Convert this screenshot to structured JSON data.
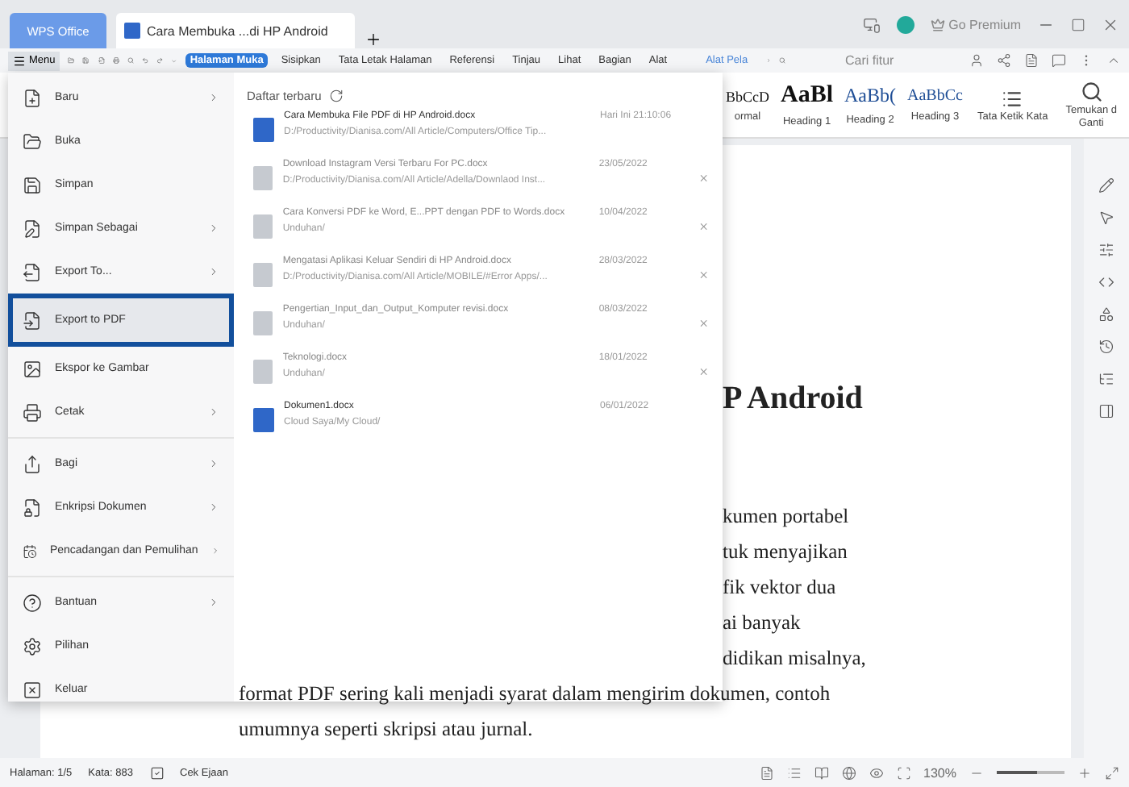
{
  "window": {
    "app_tab": "WPS Office",
    "document_tab": "Cara Membuka ...di HP Android",
    "premium": "Go Premium"
  },
  "toolbar": {
    "menu": "Menu",
    "tabs": [
      {
        "label": "Halaman Muka",
        "selected": true
      },
      {
        "label": "Sisipkan",
        "selected": false
      },
      {
        "label": "Tata Letak Halaman",
        "selected": false
      },
      {
        "label": "Referensi",
        "selected": false
      },
      {
        "label": "Tinjau",
        "selected": false
      },
      {
        "label": "Lihat",
        "selected": false
      },
      {
        "label": "Bagian",
        "selected": false
      },
      {
        "label": "Alat",
        "selected": false
      }
    ],
    "context_tab": "Alat Pela",
    "search": {
      "placeholder": "Cari fitur"
    }
  },
  "ribbon": {
    "styles": [
      {
        "preview": "BbCcD",
        "name": "ormal",
        "kind": "normal"
      },
      {
        "preview": "AaBl",
        "name": "Heading 1",
        "kind": "h1"
      },
      {
        "preview": "AaBb(",
        "name": "Heading 2",
        "kind": "h2"
      },
      {
        "preview": "AaBbCc",
        "name": "Heading 3",
        "kind": "h3"
      }
    ],
    "typesetting": "Tata Ketik Kata",
    "find": [
      "Temukan d",
      "Ganti"
    ]
  },
  "file_menu": {
    "groups": [
      [
        {
          "label": "Baru",
          "submenu": true,
          "selected": false
        },
        {
          "label": "Buka",
          "submenu": false,
          "selected": false
        },
        {
          "label": "Simpan",
          "submenu": false,
          "selected": false
        },
        {
          "label": "Simpan Sebagai",
          "submenu": true,
          "selected": false
        },
        {
          "label": "Export To...",
          "submenu": true,
          "selected": false
        },
        {
          "label": "Export to PDF",
          "submenu": false,
          "selected": true
        },
        {
          "label": "Ekspor ke Gambar",
          "submenu": false,
          "selected": false
        },
        {
          "label": "Cetak",
          "submenu": true,
          "selected": false
        }
      ],
      [
        {
          "label": "Bagi",
          "submenu": true,
          "selected": false
        },
        {
          "label": "Enkripsi Dokumen",
          "submenu": true,
          "selected": false
        },
        {
          "label": "Pencadangan dan Pemulihan",
          "submenu": true,
          "selected": false
        }
      ],
      [
        {
          "label": "Bantuan",
          "submenu": true,
          "selected": false
        },
        {
          "label": "Pilihan",
          "submenu": false,
          "selected": false
        },
        {
          "label": "Keluar",
          "submenu": false,
          "selected": false
        }
      ]
    ]
  },
  "recent": {
    "title": "Daftar terbaru",
    "files": [
      {
        "name": "Cara Membuka File PDF di HP Android.docx",
        "path": "D:/Productivity/Dianisa.com/All Article/Computers/Office Tip...",
        "date": "Hari Ini 21:10:06",
        "active": true,
        "removable": false
      },
      {
        "name": "Download Instagram Versi Terbaru For PC.docx",
        "path": "D:/Productivity/Dianisa.com/All Article/Adella/Downlaod Inst...",
        "date": "23/05/2022",
        "active": false,
        "removable": true
      },
      {
        "name": "Cara Konversi PDF ke Word, E...PPT dengan PDF to Words.docx",
        "path": "Unduhan/",
        "date": "10/04/2022",
        "active": false,
        "removable": true
      },
      {
        "name": "Mengatasi Aplikasi Keluar Sendiri di HP Android.docx",
        "path": "D:/Productivity/Dianisa.com/All Article/MOBILE/#Error Apps/...",
        "date": "28/03/2022",
        "active": false,
        "removable": true
      },
      {
        "name": "Pengertian_Input_dan_Output_Komputer revisi.docx",
        "path": "Unduhan/",
        "date": "08/03/2022",
        "active": false,
        "removable": true
      },
      {
        "name": "Teknologi.docx",
        "path": "Unduhan/",
        "date": "18/01/2022",
        "active": false,
        "removable": true
      },
      {
        "name": "Dokumen1.docx",
        "path": "Cloud Saya/My Cloud/",
        "date": "06/01/2022",
        "active": true,
        "removable": false
      }
    ]
  },
  "document": {
    "heading": "P Android",
    "lines": [
      {
        "text": "kumen portabel",
        "covered": true
      },
      {
        "text": "tuk menyajikan",
        "covered": true
      },
      {
        "text": "fik vektor dua",
        "covered": true
      },
      {
        "text": "ai banyak",
        "covered": true
      },
      {
        "text": "didikan misalnya,",
        "covered": true
      },
      {
        "text": "format PDF sering kali menjadi syarat dalam mengirim dokumen, contoh",
        "covered": false
      },
      {
        "text": "umumnya seperti skripsi atau jurnal.",
        "covered": false
      }
    ]
  },
  "status_bar": {
    "page": "Halaman: 1/5",
    "words": "Kata: 883",
    "spell": "Cek Ejaan",
    "zoom": "130%",
    "zoom_slider": {
      "level": 0.6
    }
  }
}
